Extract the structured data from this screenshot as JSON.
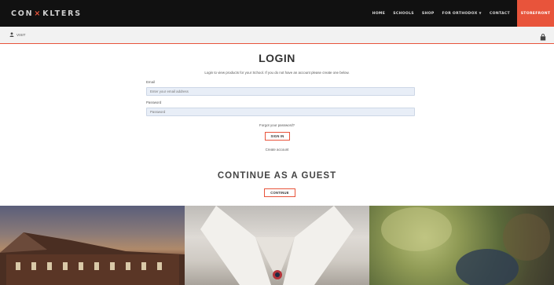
{
  "header": {
    "brand_left": "CON",
    "brand_mark": "×",
    "brand_right": "KLTERS",
    "nav": [
      {
        "label": "HOME"
      },
      {
        "label": "SCHOOLS"
      },
      {
        "label": "SHOP"
      },
      {
        "label": "FOR ORTHODOX",
        "has_caret": true
      },
      {
        "label": "CONTACT"
      }
    ],
    "cta_label": "STOREFRONT"
  },
  "subbar": {
    "user_label": "VISIT"
  },
  "login": {
    "title": "LOGIN",
    "subtitle": "Login to view products for your School. If you do not have an account please create one below.",
    "email_label": "Email",
    "email_placeholder": "Enter your email address",
    "password_label": "Password",
    "password_placeholder": "Password",
    "forgot_link": "Forgot your password?",
    "signin_button": "SIGN IN",
    "create_link": "Create account"
  },
  "guest": {
    "title": "CONTINUE AS A GUEST",
    "button": "CONTINUE"
  },
  "colors": {
    "accent": "#e8543b",
    "topbar": "#111111",
    "subbar": "#f2f2f2"
  }
}
